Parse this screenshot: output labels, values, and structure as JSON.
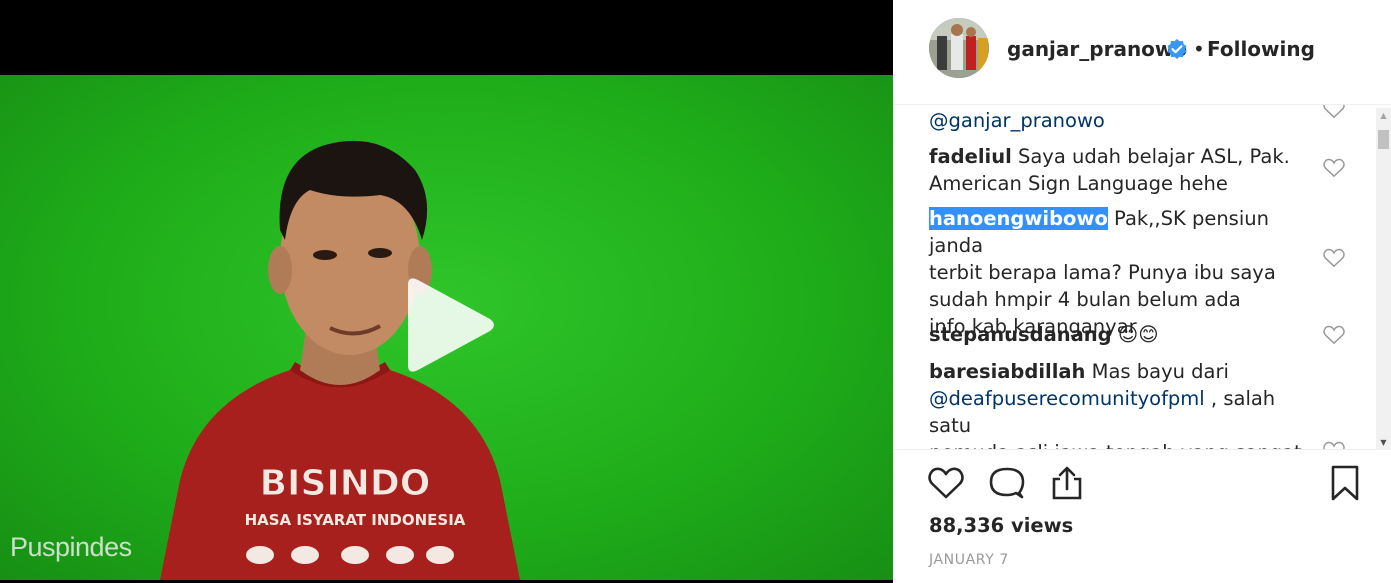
{
  "media": {
    "watermark": "Puspindes",
    "shirt_line1": "BISINDO",
    "shirt_line2": "HASA ISYARAT INDONESIA"
  },
  "header": {
    "username": "ganjar_pranowo",
    "separator": "•",
    "follow_status": "Following"
  },
  "comments": [
    {
      "mention": "@ganjar_pranowo"
    },
    {
      "user": "fadeliul",
      "text": " Saya udah belajar ASL, Pak.",
      "text2": "American Sign Language hehe"
    },
    {
      "user": "hanoengwibowo",
      "text": " Pak,,SK pensiun janda",
      "text2": "terbit berapa lama? Punya ibu saya",
      "text3": "sudah hmpir 4 bulan belum ada",
      "text4": "info,kab.karanganyar"
    },
    {
      "user": "stepanusdanang",
      "emoji": "😊😊"
    },
    {
      "user": "baresiabdillah",
      "text": " Mas bayu dari",
      "mention": "@deafpuserecomunityofpml",
      "text2": " , salah satu",
      "text3": "pemuda asli jawa tengah yang sangat"
    }
  ],
  "stats": {
    "views": "88,336 views",
    "date": "JANUARY 7"
  },
  "colors": {
    "green_screen": "#1fae1a",
    "mention": "#003569",
    "verified": "#3897f0",
    "selection": "#3390ff"
  }
}
